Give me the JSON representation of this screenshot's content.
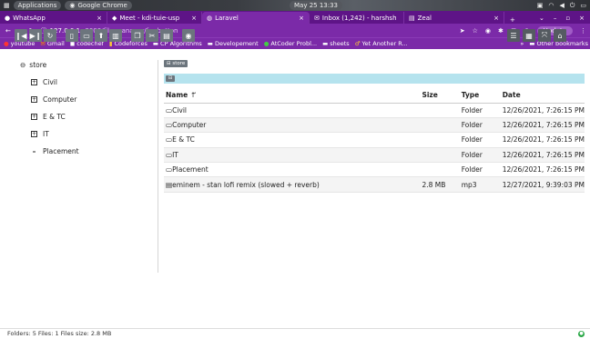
{
  "os": {
    "applications": "Applications",
    "chrome": "Google Chrome",
    "clock": "May 25 13:33"
  },
  "tabs": [
    {
      "label": "WhatsApp",
      "icon": "whatsapp-icon"
    },
    {
      "label": "Meet - kdi-tuie-usp",
      "icon": "meet-icon"
    },
    {
      "label": "Laravel",
      "icon": "laravel-icon"
    },
    {
      "label": "Inbox (1,242) - harshsh",
      "icon": "gmail-icon"
    },
    {
      "label": "Zeal",
      "icon": "zeal-icon"
    }
  ],
  "address": {
    "host": "127.0.0.1",
    "path": ":8000/file-manager/fm-button",
    "update_label": "Update"
  },
  "bookmarks": [
    "youtube",
    "Gmail",
    "codechef",
    "Codeforces",
    "CP Algorithms",
    "Developement",
    "AtCoder Probl...",
    "sheets",
    "Yet Another R..."
  ],
  "bookmarks_other": "Other bookmarks",
  "tree": {
    "root": "store",
    "items": [
      {
        "label": "Civil",
        "expander": "+"
      },
      {
        "label": "Computer",
        "expander": "+"
      },
      {
        "label": "E & TC",
        "expander": "+"
      },
      {
        "label": "IT",
        "expander": "+"
      },
      {
        "label": "Placement",
        "expander": "–"
      }
    ]
  },
  "breadcrumb": "store",
  "table": {
    "headers": {
      "name": "Name",
      "size": "Size",
      "type": "Type",
      "date": "Date"
    },
    "rows": [
      {
        "name": "Civil",
        "size": "",
        "type": "Folder",
        "date": "12/26/2021, 7:26:15 PM",
        "icon": "folder-icon"
      },
      {
        "name": "Computer",
        "size": "",
        "type": "Folder",
        "date": "12/26/2021, 7:26:15 PM",
        "icon": "folder-icon"
      },
      {
        "name": "E & TC",
        "size": "",
        "type": "Folder",
        "date": "12/26/2021, 7:26:15 PM",
        "icon": "folder-icon"
      },
      {
        "name": "IT",
        "size": "",
        "type": "Folder",
        "date": "12/26/2021, 7:26:15 PM",
        "icon": "folder-icon"
      },
      {
        "name": "Placement",
        "size": "",
        "type": "Folder",
        "date": "12/26/2021, 7:26:15 PM",
        "icon": "folder-icon"
      },
      {
        "name": "eminem - stan lofi remix (slowed + reverb)",
        "size": "2.8 MB",
        "type": "mp3",
        "date": "12/27/2021, 9:39:03 PM",
        "icon": "file-audio-icon"
      }
    ]
  },
  "status": "Folders: 5 Files: 1 Files size: 2.8 MB",
  "colors": {
    "browser_purple": "#7b2aa8",
    "tab_purple": "#5e1487",
    "disk_bar": "#b5e3ee",
    "btn_gray": "#6c757d",
    "status_ok": "#28a745"
  }
}
